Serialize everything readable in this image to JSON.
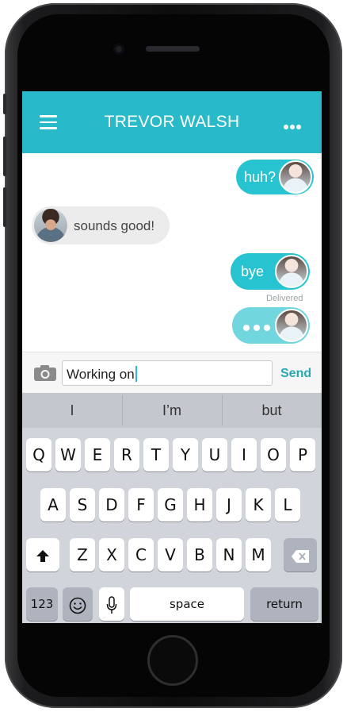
{
  "header": {
    "title": "TREVOR WALSH",
    "menu_icon": "hamburger-menu-icon",
    "more_icon": "more-dots-icon"
  },
  "colors": {
    "accent": "#28bac8",
    "bubble_out": "#28c3d1",
    "bubble_in": "#ececec",
    "send": "#28a7b4"
  },
  "messages": [
    {
      "side": "outgoing",
      "text": "huh?"
    },
    {
      "side": "incoming",
      "text": "sounds good!"
    },
    {
      "side": "outgoing",
      "text": "bye",
      "status": "Delivered"
    },
    {
      "side": "outgoing",
      "typing": true
    }
  ],
  "composer": {
    "value": "Working on",
    "send_label": "Send",
    "camera_icon": "camera-icon"
  },
  "keyboard": {
    "suggestions": [
      "I",
      "I’m",
      "but"
    ],
    "row1": [
      "Q",
      "W",
      "E",
      "R",
      "T",
      "Y",
      "U",
      "I",
      "O",
      "P"
    ],
    "row2": [
      "A",
      "S",
      "D",
      "F",
      "G",
      "H",
      "J",
      "K",
      "L"
    ],
    "row3": [
      "Z",
      "X",
      "C",
      "V",
      "B",
      "N",
      "M"
    ],
    "numbers_label": "123",
    "space_label": "space",
    "return_label": "return"
  }
}
